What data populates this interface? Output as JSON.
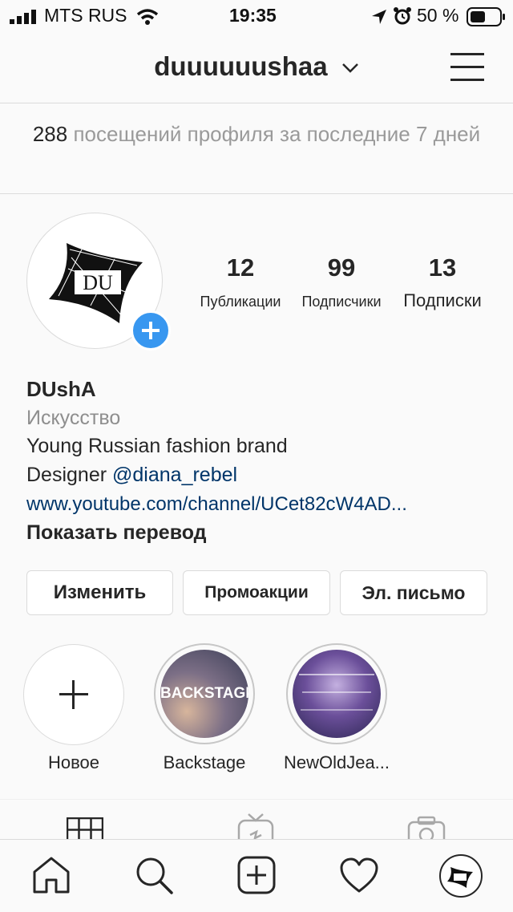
{
  "status_bar": {
    "carrier": "MTS RUS",
    "time": "19:35",
    "battery": "50 %"
  },
  "header": {
    "username": "duuuuuushaa",
    "menu_icon": "hamburger-menu-icon"
  },
  "visits": {
    "count": "288",
    "text": "посещений профиля за последние 7 дней"
  },
  "profile": {
    "avatar_text": "DU",
    "stats": [
      {
        "value": "12",
        "label": "Публикации"
      },
      {
        "value": "99",
        "label": "Подписчики"
      },
      {
        "value": "13",
        "label": "Подписки"
      }
    ],
    "name": "DUshA",
    "category": "Искусство",
    "bio_line1": "Young Russian fashion brand",
    "bio_designer": "Designer",
    "bio_mention": "@diana_rebel",
    "website": "www.youtube.com/channel/UCet82cW4AD...",
    "translate": "Показать перевод"
  },
  "buttons": {
    "edit": "Изменить",
    "promo": "Промоакции",
    "email": "Эл. письмо"
  },
  "highlights": [
    {
      "label": "Новое"
    },
    {
      "label": "Backstage",
      "cover_text": "BACKSTAGE"
    },
    {
      "label": "NewOldJea..."
    }
  ],
  "colors": {
    "accent": "#3897f0",
    "link": "#003569",
    "secondary_text": "#8e8e8e",
    "border": "#dbdbdb"
  }
}
